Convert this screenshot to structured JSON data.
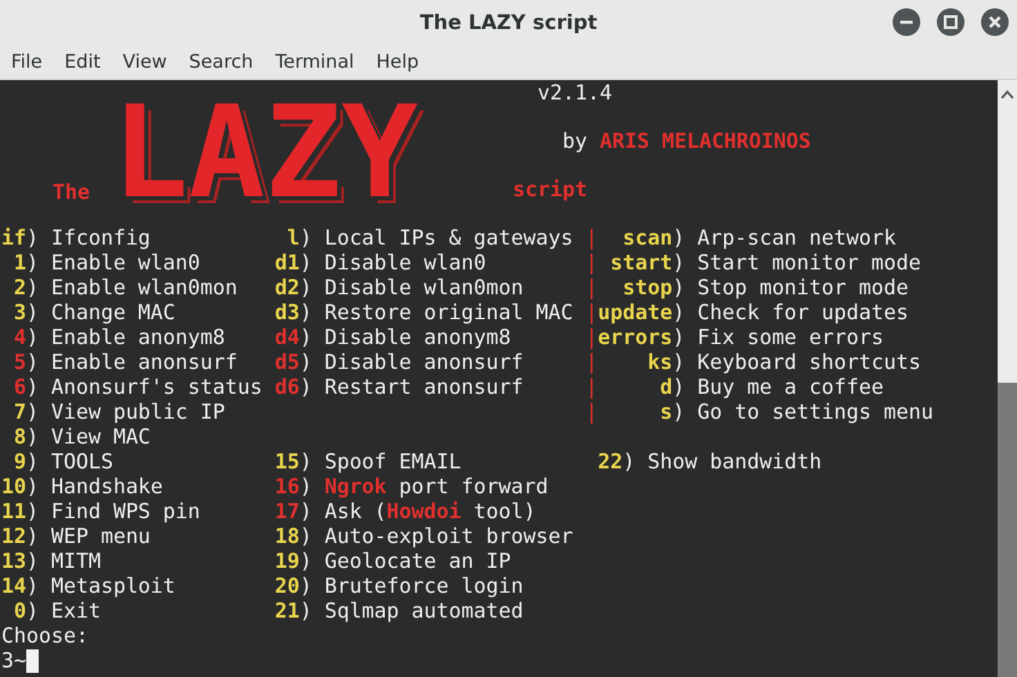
{
  "window": {
    "title": "The LAZY script"
  },
  "menu_bar": [
    "File",
    "Edit",
    "View",
    "Search",
    "Terminal",
    "Help"
  ],
  "banner": {
    "prefix": "The",
    "logo": "LAZY",
    "suffix": "script",
    "version": "v2.1.4",
    "byline": "by",
    "author": "ARIS MELACHROINOS"
  },
  "menu_rows": [
    {
      "left": {
        "key": "if",
        "close": ")",
        "label": "Ifconfig",
        "color": "#e8d44d"
      },
      "middle": {
        "key": "l",
        "close": ")",
        "label": "Local IPs & gateways",
        "color": "#e8d44d"
      },
      "right": {
        "divider": "|",
        "key": "scan",
        "close": ")",
        "label": "Arp-scan network",
        "color": "#e8d44d"
      }
    },
    {
      "left": {
        "key": "1",
        "close": ")",
        "label": "Enable wlan0",
        "color": "#e8d44d"
      },
      "middle": {
        "key": "d1",
        "close": ")",
        "label": "Disable wlan0",
        "color": "#e8d44d"
      },
      "right": {
        "divider": "|",
        "key": "start",
        "close": ")",
        "label": "Start monitor mode",
        "color": "#e8d44d"
      }
    },
    {
      "left": {
        "key": "2",
        "close": ")",
        "label": "Enable wlan0mon",
        "color": "#e8d44d"
      },
      "middle": {
        "key": "d2",
        "close": ")",
        "label": "Disable wlan0mon",
        "color": "#e8d44d"
      },
      "right": {
        "divider": "|",
        "key": "stop",
        "close": ")",
        "label": "Stop monitor mode",
        "color": "#e8d44d"
      }
    },
    {
      "left": {
        "key": "3",
        "close": ")",
        "label": "Change MAC",
        "color": "#e8d44d"
      },
      "middle": {
        "key": "d3",
        "close": ")",
        "label": "Restore original MAC",
        "color": "#e8d44d"
      },
      "right": {
        "divider": "|",
        "key": "update",
        "close": ")",
        "label": "Check for updates",
        "color": "#e8d44d"
      }
    },
    {
      "left": {
        "key": "4",
        "close": ")",
        "label": "Enable anonym8",
        "color": "#e0302e"
      },
      "middle": {
        "key": "d4",
        "close": ")",
        "label": "Disable anonym8",
        "color": "#e0302e"
      },
      "right": {
        "divider": "|",
        "key": "errors",
        "close": ")",
        "label": "Fix some errors",
        "color": "#e8d44d"
      }
    },
    {
      "left": {
        "key": "5",
        "close": ")",
        "label": "Enable anonsurf",
        "color": "#e0302e"
      },
      "middle": {
        "key": "d5",
        "close": ")",
        "label": "Disable anonsurf",
        "color": "#e0302e"
      },
      "right": {
        "divider": "|",
        "key": "ks",
        "close": ")",
        "label": "Keyboard shortcuts",
        "color": "#e8d44d"
      }
    },
    {
      "left": {
        "key": "6",
        "close": ")",
        "label": "Anonsurf's status",
        "color": "#e0302e"
      },
      "middle": {
        "key": "d6",
        "close": ")",
        "label": "Restart anonsurf",
        "color": "#e0302e"
      },
      "right": {
        "divider": "|",
        "key": "d",
        "close": ")",
        "label": "Buy me a coffee",
        "color": "#e8d44d"
      }
    },
    {
      "left": {
        "key": "7",
        "close": ")",
        "label": "View public IP",
        "color": "#e8d44d"
      },
      "right": {
        "divider": "|",
        "key": "s",
        "close": ")",
        "label": "Go to settings menu",
        "color": "#e8d44d"
      }
    },
    {
      "left": {
        "key": "8",
        "close": ")",
        "label": "View MAC",
        "color": "#e8d44d"
      }
    },
    {
      "left": {
        "key": "9",
        "close": ")",
        "label": "TOOLS",
        "color": "#e8d44d"
      },
      "middle": {
        "key": "15",
        "close": ")",
        "label": "Spoof EMAIL",
        "color": "#e8d44d"
      },
      "right": {
        "key": "22",
        "close": ")",
        "label": "Show bandwidth",
        "color": "#e8d44d"
      }
    },
    {
      "left": {
        "key": "10",
        "close": ")",
        "label": "Handshake",
        "color": "#e8d44d"
      },
      "middle": {
        "key": "16",
        "close": ")",
        "label": "**Ngrok** port forward",
        "color": "#e0302e"
      }
    },
    {
      "left": {
        "key": "11",
        "close": ")",
        "label": "Find WPS pin",
        "color": "#e8d44d"
      },
      "middle": {
        "key": "17",
        "close": ")",
        "label": "Ask (**Howdoi** tool)",
        "color": "#e0302e"
      }
    },
    {
      "left": {
        "key": "12",
        "close": ")",
        "label": "WEP menu",
        "color": "#e8d44d"
      },
      "middle": {
        "key": "18",
        "close": ")",
        "label": "Auto-exploit browser",
        "color": "#e8d44d"
      }
    },
    {
      "left": {
        "key": "13",
        "close": ")",
        "label": "MITM",
        "color": "#e8d44d"
      },
      "middle": {
        "key": "19",
        "close": ")",
        "label": "Geolocate an IP",
        "color": "#e8d44d"
      }
    },
    {
      "left": {
        "key": "14",
        "close": ")",
        "label": "Metasploit",
        "color": "#e8d44d"
      },
      "middle": {
        "key": "20",
        "close": ")",
        "label": "Bruteforce login",
        "color": "#e8d44d"
      }
    },
    {
      "left": {
        "key": "0",
        "close": ")",
        "label": "Exit",
        "color": "#e8d44d"
      },
      "middle": {
        "key": "21",
        "close": ")",
        "label": "Sqlmap automated",
        "color": "#e8d44d"
      }
    }
  ],
  "prompt": {
    "label": "Choose:",
    "input": "3~"
  }
}
